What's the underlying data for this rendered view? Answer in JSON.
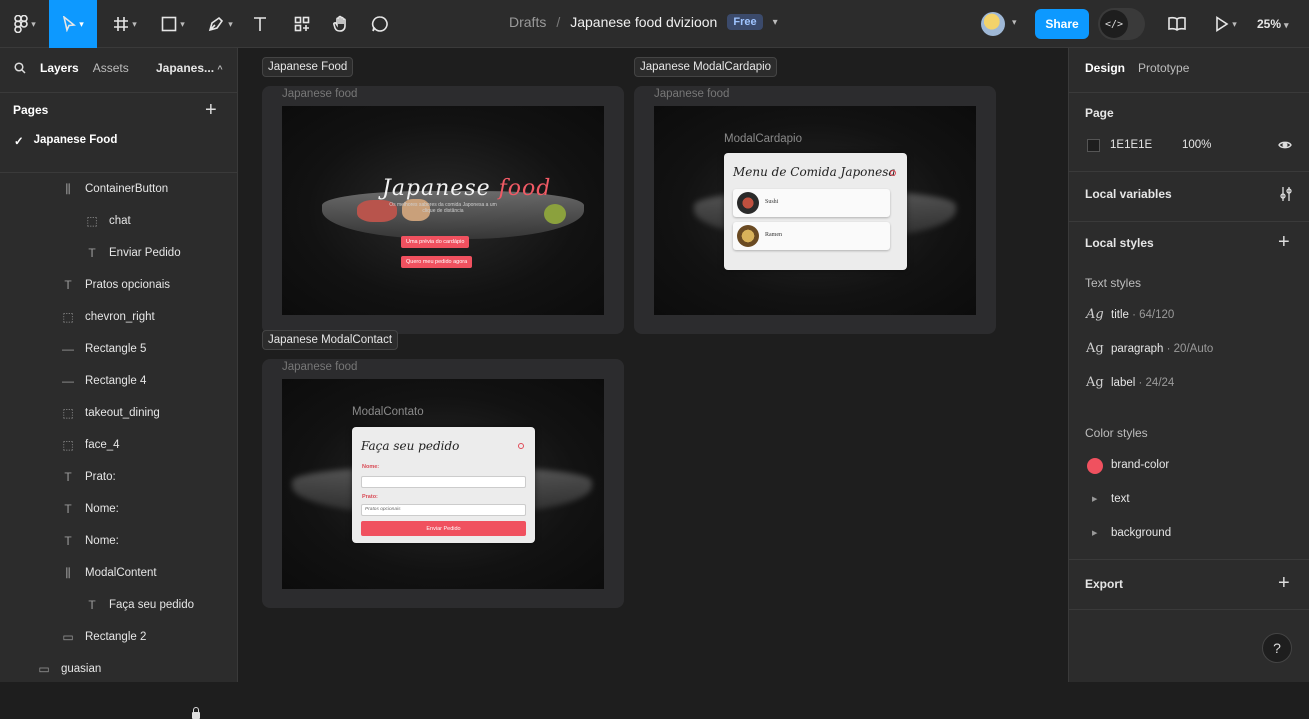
{
  "toolbar": {
    "breadcrumb_root": "Drafts",
    "breadcrumb_sep": "/",
    "file_name": "Japanese food dvizioon",
    "plan_badge": "Free",
    "share_label": "Share",
    "zoom": "25%",
    "icons": [
      "figma-menu-icon",
      "move-tool-icon",
      "frame-tool-icon",
      "shape-tool-icon",
      "pen-tool-icon",
      "text-tool-icon",
      "resources-icon",
      "hand-tool-icon",
      "comment-tool-icon",
      "library-icon",
      "play-icon"
    ]
  },
  "left_panel": {
    "tabs": [
      "Layers",
      "Assets"
    ],
    "page_selector": "Japanes...",
    "pages_heading": "Pages",
    "current_page": "Japanese Food",
    "layers": [
      {
        "name": "ContainerButton",
        "icon": "auto-layout-icon",
        "indent": 1
      },
      {
        "name": "chat",
        "icon": "component-placeholder-icon",
        "indent": 2
      },
      {
        "name": "Enviar Pedido",
        "icon": "text-layer-icon",
        "indent": 2
      },
      {
        "name": "Pratos opcionais",
        "icon": "text-layer-icon",
        "indent": 1
      },
      {
        "name": "chevron_right",
        "icon": "component-placeholder-icon",
        "indent": 1
      },
      {
        "name": "Rectangle 5",
        "icon": "line-icon",
        "indent": 1
      },
      {
        "name": "Rectangle 4",
        "icon": "line-icon",
        "indent": 1
      },
      {
        "name": "takeout_dining",
        "icon": "component-placeholder-icon",
        "indent": 1
      },
      {
        "name": "face_4",
        "icon": "component-placeholder-icon",
        "indent": 1
      },
      {
        "name": "Prato:",
        "icon": "text-layer-icon",
        "indent": 1
      },
      {
        "name": "Nome:",
        "icon": "text-layer-icon",
        "indent": 1
      },
      {
        "name": "Nome:",
        "icon": "text-layer-icon",
        "indent": 1
      },
      {
        "name": "ModalContent",
        "icon": "auto-layout-icon",
        "indent": 1
      },
      {
        "name": "Faça seu pedido",
        "icon": "text-layer-icon",
        "indent": 2
      },
      {
        "name": "Rectangle 2",
        "icon": "rectangle-icon",
        "indent": 1
      },
      {
        "name": "guasian",
        "icon": "image-icon",
        "indent": 0
      }
    ]
  },
  "canvas": {
    "frames": [
      {
        "tag": "Japanese Food",
        "title": "Japanese food"
      },
      {
        "tag": "Japanese ModalCardapio",
        "title": "Japanese food"
      },
      {
        "tag": "Japanese ModalContact",
        "title": "Japanese food"
      }
    ],
    "hero": {
      "title_main": "Japanese",
      "title_accent": "food",
      "subtitle": "Os melhores sabores da comida Japonesa a um clique de distância",
      "cta_menu": "Uma prévia do cardápio",
      "cta_order": "Quero meu pedido agora"
    },
    "modal_cardapio": {
      "label": "ModalCardapio",
      "title": "Menu de Comida Japonesa",
      "items": [
        "Sushi",
        "Ramen"
      ]
    },
    "modal_contato": {
      "label": "ModalContato",
      "title": "Faça seu pedido",
      "name_label": "Nome:",
      "dish_label": "Prato:",
      "dish_placeholder": "Pratos opcionais",
      "submit": "Enviar Pedido"
    }
  },
  "right_panel": {
    "tabs": [
      "Design",
      "Prototype"
    ],
    "page_heading": "Page",
    "page_color": "1E1E1E",
    "page_opacity": "100%",
    "local_variables": "Local variables",
    "local_styles": "Local styles",
    "text_styles_heading": "Text styles",
    "text_styles": [
      {
        "name": "title",
        "meta": " · 64/120"
      },
      {
        "name": "paragraph",
        "meta": " · 20/Auto"
      },
      {
        "name": "label",
        "meta": " · 24/24"
      }
    ],
    "color_styles_heading": "Color styles",
    "color_styles": [
      "brand-color",
      "text",
      "background"
    ],
    "brand_color": "#F0515F",
    "export_heading": "Export",
    "help": "?"
  }
}
